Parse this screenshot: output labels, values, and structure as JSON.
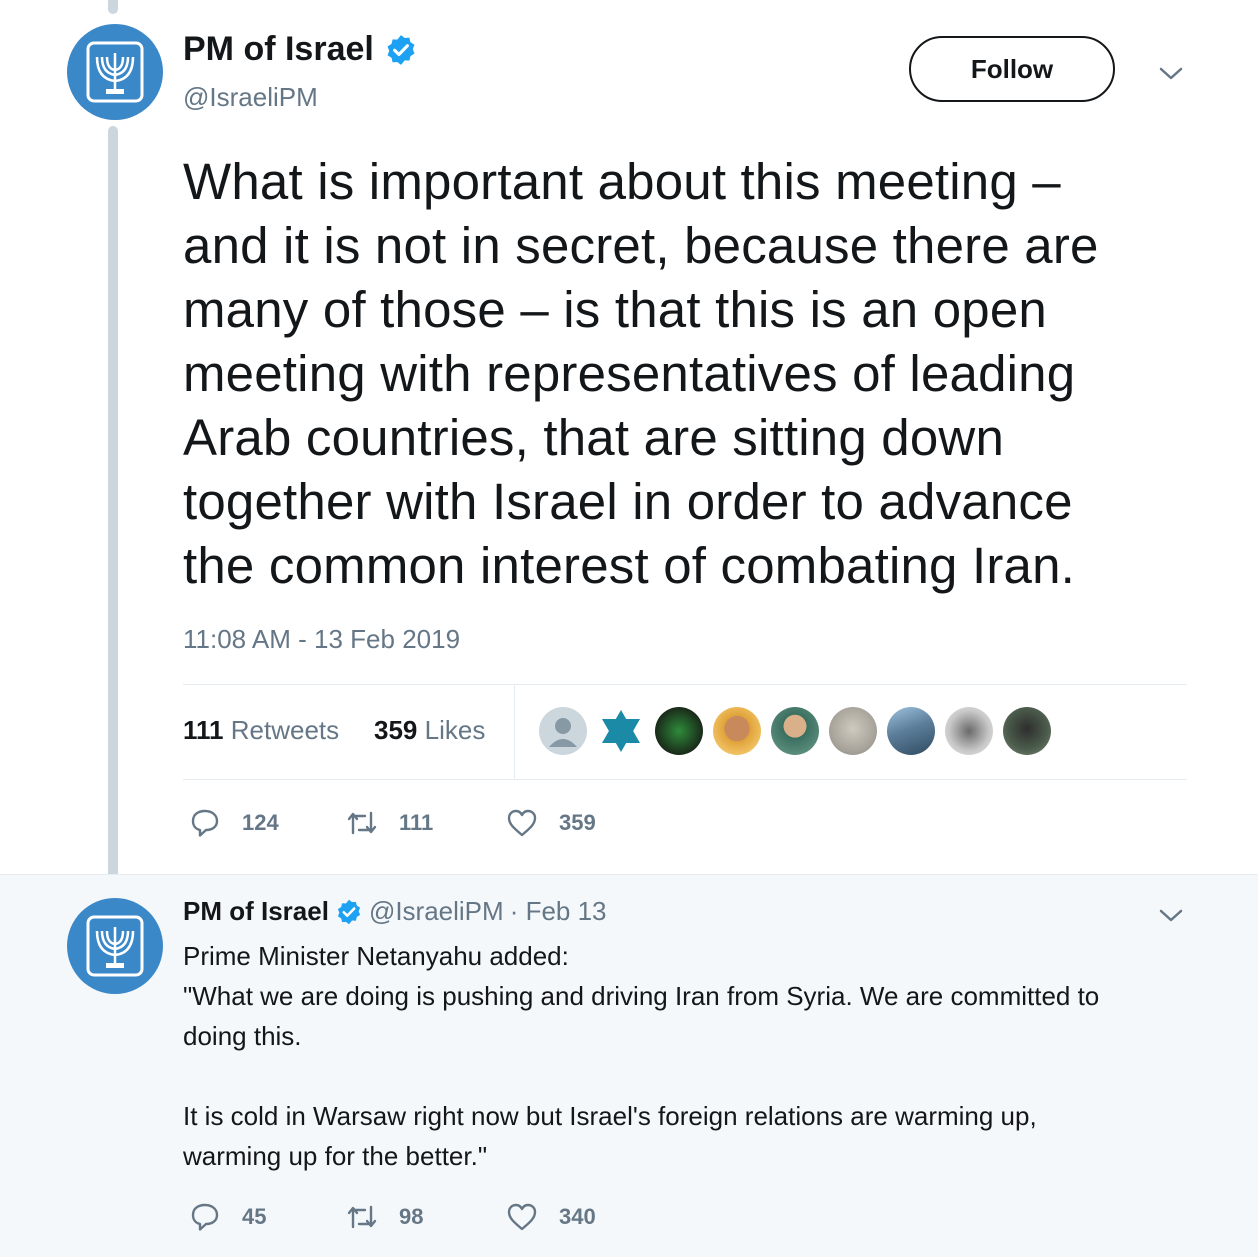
{
  "main_tweet": {
    "author_name": "PM of Israel",
    "author_handle": "@IsraeliPM",
    "follow_label": "Follow",
    "text_lines": [
      "What is important about this meeting –",
      "and it is not in secret, because there are",
      "many of those – is that this is an open",
      "meeting with representatives of leading",
      "Arab countries, that are sitting down",
      "together with Israel in order to advance",
      "the common interest of combating Iran."
    ],
    "timestamp": "11:08 AM - 13 Feb 2019",
    "retweets_count": "111",
    "retweets_label": "Retweets",
    "likes_count": "359",
    "likes_label": "Likes",
    "actions": {
      "replies": "124",
      "retweets": "111",
      "likes": "359"
    }
  },
  "reply_tweet": {
    "author_name": "PM of Israel",
    "author_handle": "@IsraeliPM",
    "date": "· Feb 13",
    "lines": [
      "Prime Minister Netanyahu added:",
      "\"What we are doing is pushing and driving Iran from Syria. We are committed to",
      "doing this.",
      "",
      "It is cold in Warsaw right now but Israel's foreign relations are warming up,",
      "warming up for the better.\""
    ],
    "actions": {
      "replies": "45",
      "retweets": "98",
      "likes": "340"
    }
  },
  "colors": {
    "accent": "#1da1f2",
    "avatar_bg": "#3b88c9",
    "muted": "#657786",
    "text": "#14171a"
  },
  "icons": [
    "emblem-avatar-icon",
    "verified-icon",
    "chevron-down-icon",
    "reply-icon",
    "retweet-icon",
    "like-icon"
  ]
}
